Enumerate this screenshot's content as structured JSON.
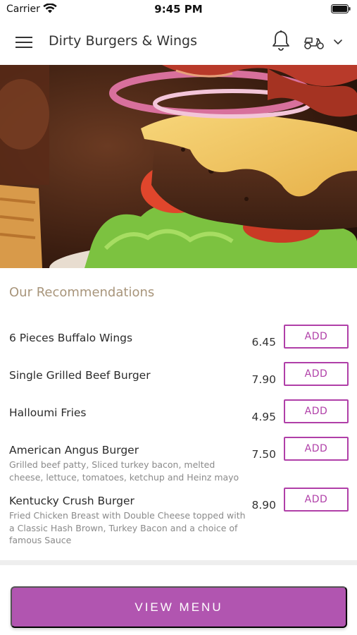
{
  "status_bar": {
    "carrier": "Carrier",
    "time": "9:45 PM"
  },
  "header": {
    "title": "Dirty Burgers & Wings",
    "icons": [
      "menu-icon",
      "bell-icon",
      "scooter-icon",
      "chevron-down-icon"
    ]
  },
  "hero": {
    "subject": "burger-photo"
  },
  "recommendations": {
    "title": "Our Recommendations",
    "items": [
      {
        "name": "6 Pieces Buffalo Wings",
        "description": "",
        "price": "6.45",
        "add_label": "ADD"
      },
      {
        "name": "Single Grilled Beef Burger",
        "description": "",
        "price": "7.90",
        "add_label": "ADD"
      },
      {
        "name": "Halloumi Fries",
        "description": "",
        "price": "4.95",
        "add_label": "ADD"
      },
      {
        "name": "American Angus Burger",
        "description": "Grilled beef patty, Sliced turkey bacon, melted cheese, lettuce, tomatoes, ketchup and Heinz mayo",
        "price": "7.50",
        "add_label": "ADD"
      },
      {
        "name": "Kentucky Crush Burger",
        "description": "Fried Chicken Breast with Double Cheese topped with a Classic Hash Brown, Turkey Bacon and a choice of famous Sauce",
        "price": "8.90",
        "add_label": "ADD"
      }
    ]
  },
  "footer": {
    "view_menu_label": "VIEW MENU"
  },
  "colors": {
    "accent": "#b03fa8",
    "button_fill": "#b155b0",
    "section_title": "#a8957b"
  }
}
